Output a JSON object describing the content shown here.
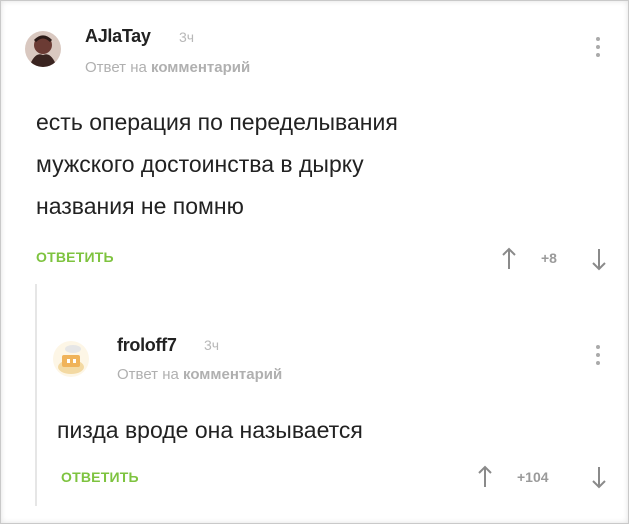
{
  "comments": [
    {
      "username": "AJlaTay",
      "time": "3ч",
      "reply_prefix": "Ответ на",
      "reply_target": "комментарий",
      "lines": [
        "есть операция по переделывания",
        "мужского достоинства в дырку",
        "названия не помню"
      ],
      "reply_label": "ОТВЕТИТЬ",
      "rating": "+8"
    },
    {
      "username": "froloff7",
      "time": "3ч",
      "reply_prefix": "Ответ на",
      "reply_target": "комментарий",
      "lines": [
        "пизда вроде она называется"
      ],
      "reply_label": "ОТВЕТИТЬ",
      "rating": "+104"
    }
  ],
  "colors": {
    "accent_green": "#7ec33f",
    "muted_text": "#b0b0b0"
  },
  "icons": {
    "menu": "vertical-dots-icon",
    "upvote": "arrow-up-icon",
    "downvote": "arrow-down-icon"
  }
}
